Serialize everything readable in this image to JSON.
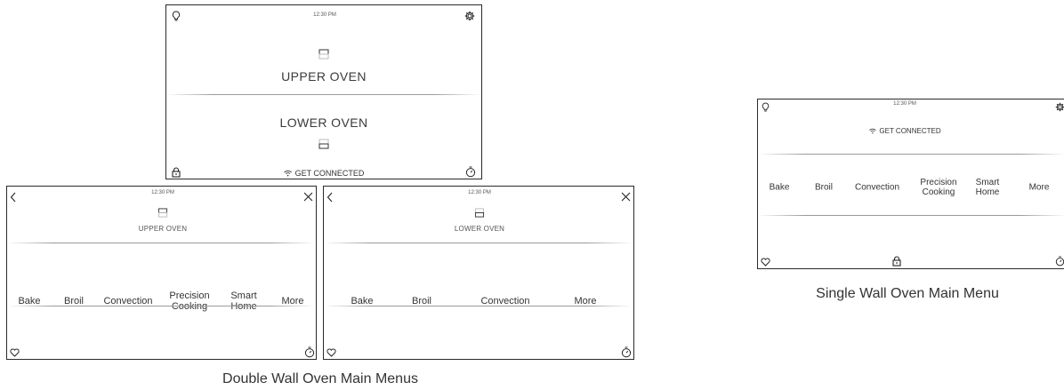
{
  "top_screen": {
    "time": "12:30 PM",
    "upper_label": "UPPER OVEN",
    "lower_label": "LOWER OVEN",
    "connect_label": "GET CONNECTED",
    "icons": [
      "lightbulb-icon",
      "gear-icon",
      "lock-icon",
      "timer-icon",
      "wifi-icon",
      "oven-upper-icon",
      "oven-lower-icon"
    ]
  },
  "upper_screen": {
    "time": "12:30 PM",
    "title": "UPPER OVEN",
    "menu": [
      {
        "line1": "Bake",
        "line2": ""
      },
      {
        "line1": "Broil",
        "line2": ""
      },
      {
        "line1": "Convection",
        "line2": ""
      },
      {
        "line1": "Precision",
        "line2": "Cooking"
      },
      {
        "line1": "Smart",
        "line2": "Home"
      },
      {
        "line1": "More",
        "line2": ""
      }
    ],
    "icons": [
      "back-icon",
      "close-icon",
      "heart-icon",
      "timer-icon",
      "oven-upper-icon"
    ]
  },
  "lower_screen": {
    "time": "12:30 PM",
    "title": "LOWER OVEN",
    "menu": [
      {
        "line1": "Bake",
        "line2": ""
      },
      {
        "line1": "Broil",
        "line2": ""
      },
      {
        "line1": "Convection",
        "line2": ""
      },
      {
        "line1": "More",
        "line2": ""
      }
    ],
    "icons": [
      "back-icon",
      "close-icon",
      "heart-icon",
      "timer-icon",
      "oven-lower-icon"
    ]
  },
  "single_screen": {
    "time": "12:30 PM",
    "connect_label": "GET CONNECTED",
    "menu": [
      {
        "line1": "Bake",
        "line2": ""
      },
      {
        "line1": "Broil",
        "line2": ""
      },
      {
        "line1": "Convection",
        "line2": ""
      },
      {
        "line1": "Precision",
        "line2": "Cooking"
      },
      {
        "line1": "Smart",
        "line2": "Home"
      },
      {
        "line1": "More",
        "line2": ""
      }
    ],
    "icons": [
      "lightbulb-icon",
      "gear-icon",
      "heart-icon",
      "lock-icon",
      "timer-icon",
      "wifi-icon"
    ]
  },
  "captions": {
    "single": "Single Wall Oven Main Menu",
    "double": "Double Wall Oven Main Menus"
  }
}
